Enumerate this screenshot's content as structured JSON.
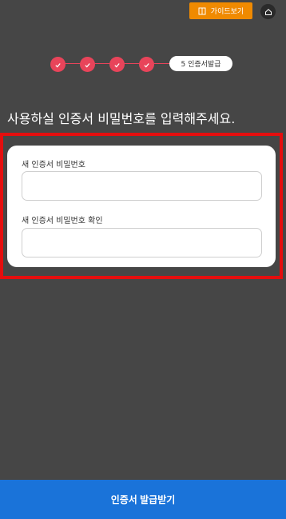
{
  "topbar": {
    "guide_label": "가이드보기"
  },
  "stepper": {
    "completed_steps": [
      1,
      2,
      3,
      4
    ],
    "current_label": "5 인증서발급"
  },
  "heading": "사용하실 인증서 비밀번호를 입력해주세요.",
  "form": {
    "new_password_label": "새 인증서 비밀번호",
    "new_password_value": "",
    "confirm_password_label": "새 인증서 비밀번호 확인",
    "confirm_password_value": ""
  },
  "submit_label": "인증서 발급받기",
  "colors": {
    "background": "#464646",
    "accent_step": "#e8445a",
    "guide_button": "#f08a00",
    "submit_button": "#1a73d9",
    "highlight_border": "#e40e0e"
  }
}
